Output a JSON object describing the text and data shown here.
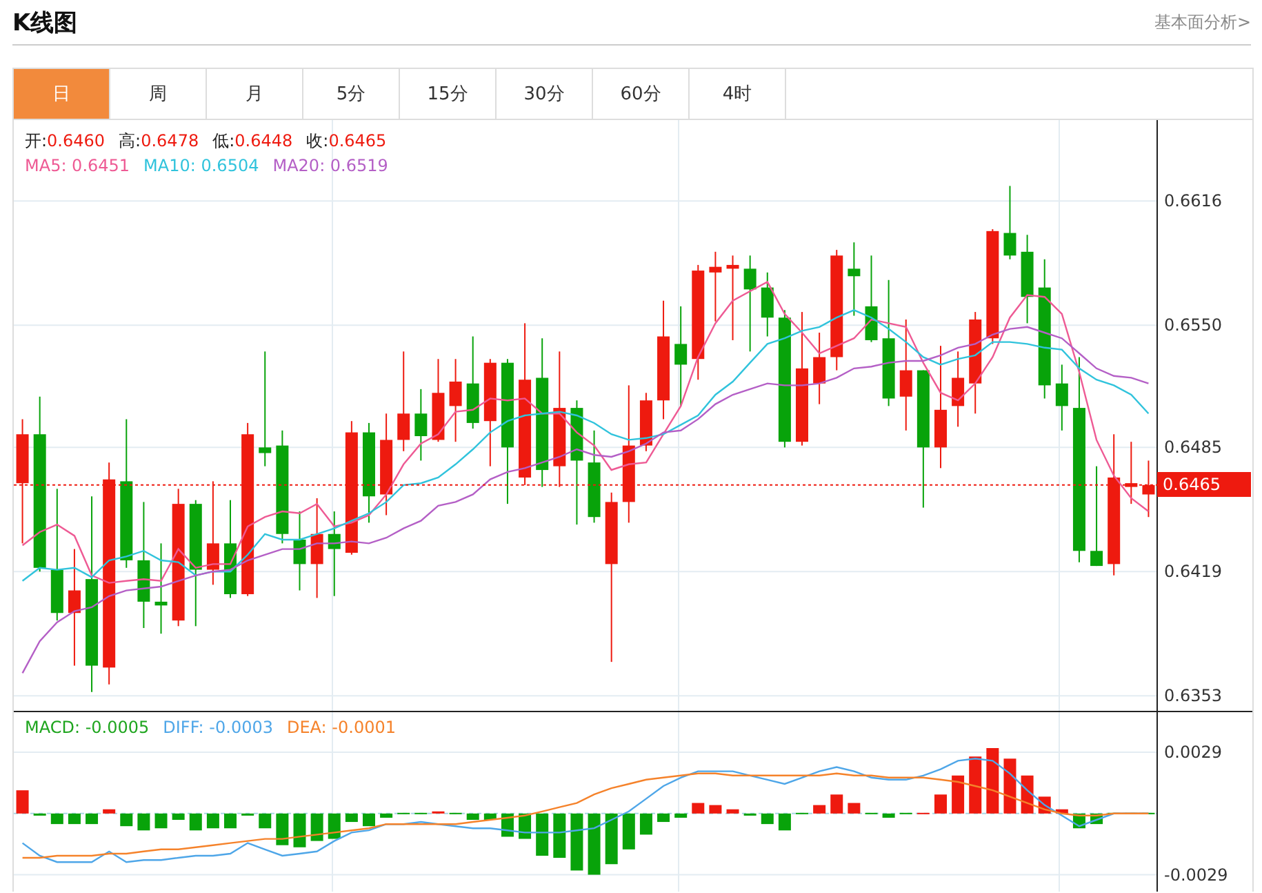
{
  "header": {
    "title": "K线图",
    "link": "基本面分析>"
  },
  "tabs": [
    {
      "label": "日",
      "selected": true
    },
    {
      "label": "周",
      "selected": false
    },
    {
      "label": "月",
      "selected": false
    },
    {
      "label": "5分",
      "selected": false
    },
    {
      "label": "15分",
      "selected": false
    },
    {
      "label": "30分",
      "selected": false
    },
    {
      "label": "60分",
      "selected": false
    },
    {
      "label": "4时",
      "selected": false
    }
  ],
  "price_chart": {
    "ohlc_legend": [
      {
        "label": "开:",
        "value": "0.6460"
      },
      {
        "label": "高:",
        "value": "0.6478"
      },
      {
        "label": "低:",
        "value": "0.6448"
      },
      {
        "label": "收:",
        "value": "0.6465"
      }
    ],
    "legend_separator": ":",
    "ma_legend": [
      {
        "value": "0.6451",
        "color": "#ee5a94"
      },
      {
        "value": "0.6504",
        "color": "#30c3dc"
      },
      {
        "value": "0.6519",
        "color": "#b45fc6"
      }
    ],
    "chart_data": {
      "type": "candlestick",
      "grid": true,
      "categories": [
        null,
        null,
        null,
        null,
        null,
        null,
        null,
        null,
        null,
        null,
        null,
        null,
        null,
        null,
        null,
        null,
        null,
        null,
        null,
        null,
        null,
        null,
        null,
        null,
        null,
        null,
        null,
        null,
        null,
        null,
        null,
        null,
        null,
        null,
        null,
        null,
        null,
        null,
        null,
        null,
        null,
        null,
        null,
        null,
        null,
        null,
        null,
        null,
        null,
        null,
        null,
        null,
        null,
        null,
        null,
        null,
        null,
        null,
        null,
        null,
        null,
        null,
        null,
        null,
        null,
        null
      ],
      "ohlc": [
        [
          0.6466,
          0.65,
          0.6434,
          0.6492
        ],
        [
          0.6492,
          0.6512,
          0.6419,
          0.6421
        ],
        [
          0.642,
          0.6463,
          0.6393,
          0.6397
        ],
        [
          0.6397,
          0.6431,
          0.6369,
          0.6409
        ],
        [
          0.6415,
          0.6459,
          0.6355,
          0.6369
        ],
        [
          0.6368,
          0.6477,
          0.6359,
          0.6468
        ],
        [
          0.6467,
          0.65,
          0.6421,
          0.6425
        ],
        [
          0.6425,
          0.6456,
          0.6389,
          0.6403
        ],
        [
          0.6403,
          0.6434,
          0.6386,
          0.6401
        ],
        [
          0.6393,
          0.6463,
          0.639,
          0.6455
        ],
        [
          0.6455,
          0.6457,
          0.639,
          0.642
        ],
        [
          0.642,
          0.6467,
          0.6412,
          0.6434
        ],
        [
          0.6434,
          0.6457,
          0.6405,
          0.6407
        ],
        [
          0.6407,
          0.6498,
          0.6406,
          0.6492
        ],
        [
          0.6485,
          0.6536,
          0.6475,
          0.6482
        ],
        [
          0.6486,
          0.6494,
          0.6434,
          0.6439
        ],
        [
          0.6436,
          0.6451,
          0.6409,
          0.6423
        ],
        [
          0.6423,
          0.6458,
          0.6405,
          0.6439
        ],
        [
          0.6439,
          0.6451,
          0.6406,
          0.6431
        ],
        [
          0.6429,
          0.6499,
          0.6428,
          0.6493
        ],
        [
          0.6493,
          0.6498,
          0.6445,
          0.6459
        ],
        [
          0.646,
          0.6503,
          0.6449,
          0.6489
        ],
        [
          0.6489,
          0.6536,
          0.6483,
          0.6503
        ],
        [
          0.6503,
          0.6516,
          0.6478,
          0.6491
        ],
        [
          0.6489,
          0.6532,
          0.6488,
          0.6514
        ],
        [
          0.6507,
          0.6532,
          0.6488,
          0.652
        ],
        [
          0.6519,
          0.6544,
          0.6495,
          0.6498
        ],
        [
          0.6499,
          0.6532,
          0.6475,
          0.653
        ],
        [
          0.653,
          0.6532,
          0.6455,
          0.6485
        ],
        [
          0.6469,
          0.6551,
          0.6465,
          0.6521
        ],
        [
          0.6522,
          0.6543,
          0.6464,
          0.6473
        ],
        [
          0.6475,
          0.6536,
          0.6464,
          0.6506
        ],
        [
          0.6506,
          0.651,
          0.6444,
          0.6478
        ],
        [
          0.6477,
          0.6494,
          0.6445,
          0.6448
        ],
        [
          0.6423,
          0.6461,
          0.6371,
          0.6456
        ],
        [
          0.6456,
          0.6518,
          0.6445,
          0.6486
        ],
        [
          0.6486,
          0.6514,
          0.6483,
          0.651
        ],
        [
          0.651,
          0.6563,
          0.65,
          0.6544
        ],
        [
          0.654,
          0.656,
          0.6507,
          0.6529
        ],
        [
          0.6532,
          0.6582,
          0.6521,
          0.6579
        ],
        [
          0.6578,
          0.6589,
          0.6552,
          0.6581
        ],
        [
          0.658,
          0.6587,
          0.6542,
          0.6582
        ],
        [
          0.658,
          0.6587,
          0.6536,
          0.6569
        ],
        [
          0.657,
          0.6578,
          0.6544,
          0.6554
        ],
        [
          0.6554,
          0.6558,
          0.6485,
          0.6488
        ],
        [
          0.6488,
          0.6557,
          0.6486,
          0.6527
        ],
        [
          0.6519,
          0.6546,
          0.6508,
          0.6533
        ],
        [
          0.6533,
          0.659,
          0.6526,
          0.6587
        ],
        [
          0.658,
          0.6594,
          0.6555,
          0.6576
        ],
        [
          0.656,
          0.6587,
          0.6541,
          0.6542
        ],
        [
          0.6543,
          0.6574,
          0.6507,
          0.6511
        ],
        [
          0.6512,
          0.6553,
          0.6494,
          0.6526
        ],
        [
          0.6526,
          0.6526,
          0.6453,
          0.6485
        ],
        [
          0.6485,
          0.6539,
          0.6474,
          0.6505
        ],
        [
          0.6507,
          0.6536,
          0.6496,
          0.6522
        ],
        [
          0.6519,
          0.6557,
          0.6503,
          0.6553
        ],
        [
          0.6543,
          0.6601,
          0.654,
          0.66
        ],
        [
          0.6599,
          0.6624,
          0.6585,
          0.6587
        ],
        [
          0.6589,
          0.6598,
          0.6551,
          0.6565
        ],
        [
          0.657,
          0.6585,
          0.6511,
          0.6518
        ],
        [
          0.6519,
          0.6529,
          0.6494,
          0.6507
        ],
        [
          0.6506,
          0.6533,
          0.6424,
          0.643
        ],
        [
          0.643,
          0.6475,
          0.6422,
          0.6422
        ],
        [
          0.6423,
          0.6492,
          0.6417,
          0.6469
        ],
        [
          0.6464,
          0.6488,
          0.6455,
          0.6466
        ],
        [
          0.646,
          0.6478,
          0.6448,
          0.6465
        ]
      ],
      "ylim": [
        0.6345,
        0.6659
      ],
      "yticks": [
        {
          "value": 0.6616,
          "label": "0.6616"
        },
        {
          "value": 0.655,
          "label": "0.6550"
        },
        {
          "value": 0.6485,
          "label": "0.6485"
        },
        {
          "value": 0.6419,
          "label": "0.6419"
        },
        {
          "value": 0.6353,
          "label": "0.6353"
        }
      ],
      "ref_lines": [
        {
          "axis": "y",
          "value": 0.6465,
          "label": "0.6465"
        }
      ],
      "series": [
        {
          "name": "MA5",
          "type": "line",
          "color": "#ee5a94",
          "values": [
            0.6433,
            0.644,
            0.6444,
            0.6438,
            0.6417,
            0.6413,
            0.6414,
            0.6415,
            0.6414,
            0.6431,
            0.6421,
            0.6423,
            0.6423,
            0.6443,
            0.6448,
            0.6451,
            0.645,
            0.6455,
            0.6443,
            0.6445,
            0.6449,
            0.646,
            0.6476,
            0.6487,
            0.6492,
            0.6504,
            0.6505,
            0.6511,
            0.651,
            0.6511,
            0.6503,
            0.6503,
            0.6493,
            0.6486,
            0.6473,
            0.6476,
            0.6477,
            0.6492,
            0.6507,
            0.6533,
            0.6551,
            0.6563,
            0.6568,
            0.6573,
            0.6556,
            0.6546,
            0.6535,
            0.6539,
            0.6543,
            0.6553,
            0.6551,
            0.6549,
            0.653,
            0.6514,
            0.651,
            0.6519,
            0.6533,
            0.6554,
            0.6566,
            0.6565,
            0.6556,
            0.6525,
            0.6489,
            0.647,
            0.6458,
            0.6451
          ]
        },
        {
          "name": "MA10",
          "type": "line",
          "color": "#30c3dc",
          "values": [
            0.6414,
            0.6421,
            0.642,
            0.6421,
            0.6416,
            0.6425,
            0.6427,
            0.643,
            0.6425,
            0.6424,
            0.6417,
            0.6419,
            0.6419,
            0.6428,
            0.6439,
            0.6436,
            0.6436,
            0.6439,
            0.6442,
            0.6446,
            0.645,
            0.6456,
            0.6465,
            0.6466,
            0.6469,
            0.6476,
            0.6484,
            0.6493,
            0.6499,
            0.6502,
            0.6503,
            0.6504,
            0.6502,
            0.6498,
            0.6492,
            0.6489,
            0.649,
            0.6492,
            0.6497,
            0.6502,
            0.6513,
            0.652,
            0.653,
            0.654,
            0.6543,
            0.6547,
            0.6549,
            0.6554,
            0.6558,
            0.6554,
            0.6548,
            0.6541,
            0.6533,
            0.6529,
            0.6532,
            0.6534,
            0.6541,
            0.6541,
            0.654,
            0.6538,
            0.6537,
            0.6527,
            0.6521,
            0.6518,
            0.6513,
            0.6503
          ]
        },
        {
          "name": "MA20",
          "type": "line",
          "color": "#b45fc6",
          "values": [
            0.6365,
            0.6382,
            0.6392,
            0.6398,
            0.64,
            0.6406,
            0.6409,
            0.641,
            0.6411,
            0.6414,
            0.6417,
            0.6419,
            0.642,
            0.6425,
            0.6428,
            0.6431,
            0.6431,
            0.6434,
            0.6434,
            0.6435,
            0.6434,
            0.6437,
            0.6442,
            0.6446,
            0.6454,
            0.6456,
            0.646,
            0.6468,
            0.6472,
            0.6474,
            0.6477,
            0.648,
            0.6484,
            0.6481,
            0.648,
            0.6483,
            0.6487,
            0.6493,
            0.6494,
            0.65,
            0.6508,
            0.6513,
            0.6516,
            0.6519,
            0.6518,
            0.6518,
            0.6519,
            0.6522,
            0.6527,
            0.6528,
            0.653,
            0.6531,
            0.6531,
            0.6534,
            0.6538,
            0.654,
            0.6545,
            0.6548,
            0.6549,
            0.6546,
            0.6543,
            0.6535,
            0.6527,
            0.6523,
            0.6522,
            0.6519
          ]
        }
      ]
    }
  },
  "macd_chart": {
    "legend_separator": ":",
    "legend": [
      {
        "value": "-0.0005",
        "color": "#1ea51e"
      },
      {
        "value": "-0.0003",
        "color": "#4ea6e8"
      },
      {
        "value": "-0.0001",
        "color": "#f5822a"
      }
    ],
    "chart_data": {
      "type": "bar",
      "grid": true,
      "categories": [
        null,
        null,
        null,
        null,
        null,
        null,
        null,
        null,
        null,
        null,
        null,
        null,
        null,
        null,
        null,
        null,
        null,
        null,
        null,
        null,
        null,
        null,
        null,
        null,
        null,
        null,
        null,
        null,
        null,
        null,
        null,
        null,
        null,
        null,
        null,
        null,
        null,
        null,
        null,
        null,
        null,
        null,
        null,
        null,
        null,
        null,
        null,
        null,
        null,
        null,
        null,
        null,
        null,
        null,
        null,
        null,
        null,
        null,
        null,
        null,
        null,
        null,
        null,
        null,
        null,
        null
      ],
      "ylim": [
        -0.0037,
        0.0048
      ],
      "yticks": [
        {
          "value": 0.0029,
          "label": "0.0029"
        },
        {
          "value": -0.0029,
          "label": "-0.0029"
        }
      ],
      "ref_lines": [
        {
          "axis": "y",
          "value": 0
        }
      ],
      "series": [
        {
          "name": "MACD",
          "values": [
            0.0011,
            -0.0001,
            -0.0005,
            -0.0005,
            -0.0005,
            0.0002,
            -0.0006,
            -0.0008,
            -0.0007,
            -0.0003,
            -0.0008,
            -0.0007,
            -0.0007,
            -0.0001,
            -0.0007,
            -0.0015,
            -0.0016,
            -0.0013,
            -0.0012,
            -0.0004,
            -0.0006,
            -0.0002,
            0,
            0,
            0.0001,
            0,
            -0.0003,
            -0.0003,
            -0.0011,
            -0.0012,
            -0.002,
            -0.0021,
            -0.0027,
            -0.0029,
            -0.0024,
            -0.0017,
            -0.001,
            -0.0004,
            -0.0002,
            0.0005,
            0.0004,
            0.0002,
            -0.0001,
            -0.0005,
            -0.0008,
            0,
            0.0004,
            0.0009,
            0.0005,
            0,
            -0.0002,
            0,
            0,
            0.0009,
            0.0018,
            0.0027,
            0.0031,
            0.0026,
            0.0018,
            0.0008,
            0.0002,
            -0.0007,
            -0.0005,
            0,
            0,
            0
          ],
          "colors": [
            "#ee1a0f",
            "#08a30a",
            "#08a30a",
            "#08a30a",
            "#08a30a",
            "#ee1a0f",
            "#08a30a",
            "#08a30a",
            "#08a30a",
            "#08a30a",
            "#08a30a",
            "#08a30a",
            "#08a30a",
            "#08a30a",
            "#08a30a",
            "#08a30a",
            "#08a30a",
            "#08a30a",
            "#08a30a",
            "#08a30a",
            "#08a30a",
            "#08a30a",
            "#08a30a",
            "#08a30a",
            "#ee1a0f",
            "#08a30a",
            "#08a30a",
            "#08a30a",
            "#08a30a",
            "#08a30a",
            "#08a30a",
            "#08a30a",
            "#08a30a",
            "#08a30a",
            "#08a30a",
            "#08a30a",
            "#08a30a",
            "#08a30a",
            "#08a30a",
            "#ee1a0f",
            "#ee1a0f",
            "#ee1a0f",
            "#08a30a",
            "#08a30a",
            "#08a30a",
            "#08a30a",
            "#ee1a0f",
            "#ee1a0f",
            "#ee1a0f",
            "#08a30a",
            "#08a30a",
            "#08a30a",
            "#ee1a0f",
            "#ee1a0f",
            "#ee1a0f",
            "#ee1a0f",
            "#ee1a0f",
            "#ee1a0f",
            "#ee1a0f",
            "#ee1a0f",
            "#ee1a0f",
            "#08a30a",
            "#08a30a",
            "#08a30a",
            "#08a30a",
            "#08a30a"
          ]
        },
        {
          "name": "DIFF",
          "type": "line",
          "color": "#4ea6e8",
          "values": [
            -0.0014,
            -0.002,
            -0.0023,
            -0.0023,
            -0.0023,
            -0.0018,
            -0.0023,
            -0.0022,
            -0.0022,
            -0.0021,
            -0.002,
            -0.002,
            -0.0019,
            -0.0014,
            -0.0017,
            -0.002,
            -0.0019,
            -0.0018,
            -0.0013,
            -0.0009,
            -0.0008,
            -0.0005,
            -0.0005,
            -0.0004,
            -0.0005,
            -0.0006,
            -0.0007,
            -0.0007,
            -0.0008,
            -0.0009,
            -0.0009,
            -0.0009,
            -0.0008,
            -0.0007,
            -0.0003,
            0.0001,
            0.0007,
            0.0013,
            0.0017,
            0.002,
            0.002,
            0.002,
            0.0018,
            0.0016,
            0.0014,
            0.0017,
            0.002,
            0.0022,
            0.002,
            0.0017,
            0.0016,
            0.0016,
            0.0018,
            0.0021,
            0.0025,
            0.0026,
            0.0025,
            0.0019,
            0.0011,
            0.0004,
            -0.0001,
            -0.0006,
            -0.0003,
            0,
            0,
            0
          ]
        },
        {
          "name": "DEA",
          "type": "line",
          "color": "#f5822a",
          "values": [
            -0.0021,
            -0.0021,
            -0.002,
            -0.002,
            -0.002,
            -0.0019,
            -0.0019,
            -0.0018,
            -0.0017,
            -0.0017,
            -0.0016,
            -0.0015,
            -0.0014,
            -0.0013,
            -0.0012,
            -0.0012,
            -0.0011,
            -0.001,
            -0.0009,
            -0.0008,
            -0.0007,
            -0.0005,
            -0.0005,
            -0.0005,
            -0.0005,
            -0.0005,
            -0.0004,
            -0.0003,
            -0.0002,
            -0.0001,
            0.0001,
            0.0003,
            0.0005,
            0.0009,
            0.0012,
            0.0014,
            0.0016,
            0.0017,
            0.0018,
            0.0019,
            0.0019,
            0.0018,
            0.0018,
            0.0018,
            0.0018,
            0.0018,
            0.0018,
            0.0019,
            0.0018,
            0.0018,
            0.0017,
            0.0017,
            0.0017,
            0.0016,
            0.0015,
            0.0013,
            0.0011,
            0.0008,
            0.0005,
            0.0002,
            0,
            -0.0001,
            -0.0001,
            0,
            0,
            0
          ]
        }
      ]
    }
  }
}
